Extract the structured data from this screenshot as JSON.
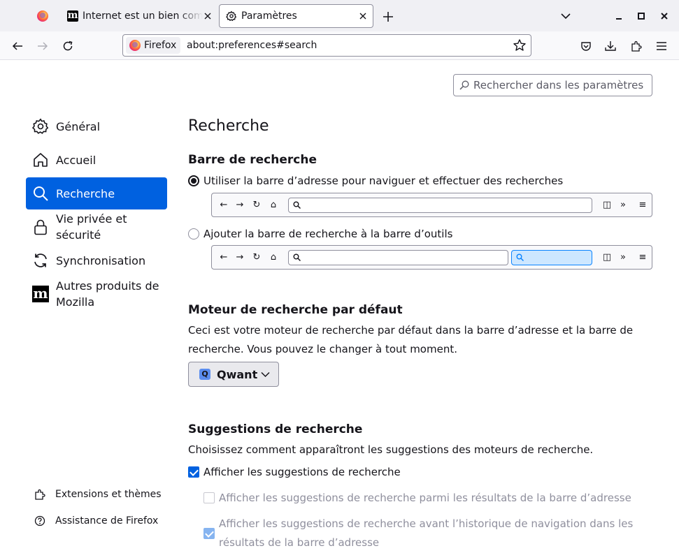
{
  "tabs": [
    {
      "label": "",
      "icon": "firefox-logo"
    },
    {
      "label": "Internet est un bien commun",
      "icon": "mozilla-logo"
    },
    {
      "label": "Paramètres",
      "icon": "gear-icon",
      "active": true
    }
  ],
  "navbar": {
    "identity_label": "Firefox",
    "url": "about:preferences#search"
  },
  "search_prefs": {
    "placeholder": "Rechercher dans les paramètres"
  },
  "sidebar": {
    "items": [
      {
        "label": "Général",
        "icon": "gear-icon"
      },
      {
        "label": "Accueil",
        "icon": "home-icon"
      },
      {
        "label": "Recherche",
        "icon": "search-icon",
        "active": true
      },
      {
        "label": "Vie privée et sécurité",
        "icon": "lock-icon"
      },
      {
        "label": "Synchronisation",
        "icon": "sync-icon"
      },
      {
        "label": "Autres produits de Mozilla",
        "icon": "mozilla-logo"
      }
    ],
    "footer": [
      {
        "label": "Extensions et thèmes",
        "icon": "puzzle-icon"
      },
      {
        "label": "Assistance de Firefox",
        "icon": "help-icon"
      }
    ]
  },
  "main": {
    "title": "Recherche",
    "search_bar": {
      "heading": "Barre de recherche",
      "option_urlbar": "Utiliser la barre d’adresse pour naviguer et effectuer des recherches",
      "option_searchbar": "Ajouter la barre de recherche à la barre d’outils",
      "selected": "urlbar"
    },
    "default_engine": {
      "heading": "Moteur de recherche par défaut",
      "description": "Ceci est votre moteur de recherche par défaut dans la barre d’adresse et la barre de recherche. Vous pouvez le changer à tout moment.",
      "engine_icon_letter": "Q",
      "engine_name": "Qwant"
    },
    "suggestions": {
      "heading": "Suggestions de recherche",
      "description": "Choisissez comment apparaîtront les suggestions des moteurs de recherche.",
      "show_suggestions": "Afficher les suggestions de recherche",
      "show_in_results": "Afficher les suggestions de recherche parmi les résultats de la barre d’adresse",
      "show_before_history": "Afficher les suggestions de recherche avant l’historique de navigation dans les résultats de la barre d’adresse"
    }
  },
  "colors": {
    "accent": "#0061e0",
    "tabstrip": "#f0f0f4",
    "text": "#15141a"
  }
}
